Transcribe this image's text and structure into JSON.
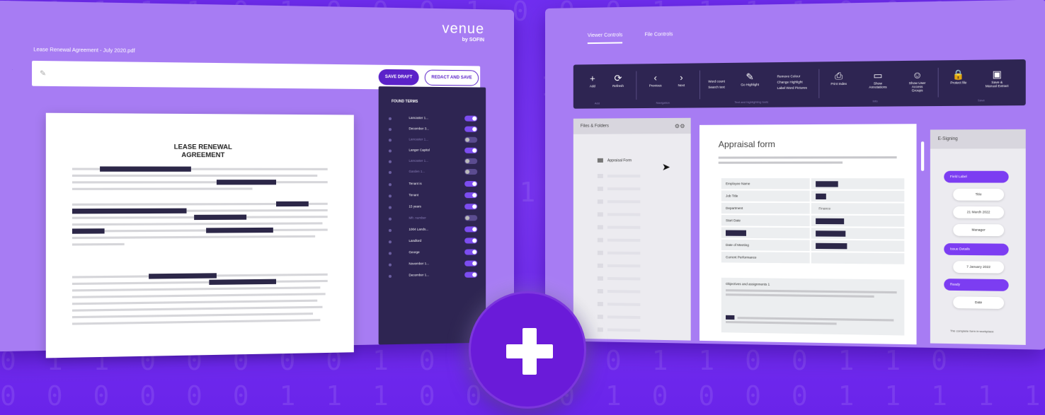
{
  "background": {
    "binary_rows": [
      "0 1 1 1 1 0 1 0 0 0 1      0 0      0 1 1 1 1 0 0      1 0 0 1",
      "0 1 0 0     1       0 1 0 1 1 0 1 0 0 0 0      1 1 0 1 0      0",
      "0 1 1 0 1 1 0 0 0 0 1 1     0 1 0 1 1     1      1 0 0 1 1 0",
      "0 1 1 0 0      0 0      0 1 0 1      1 0      0 1 1      0 0 1 1 0",
      "0 0 0 0 0 0 1 1 1 0 0      1 0 1 0 0 0 0 1 1 1 1 1 0 1 1 0 1 0 1"
    ]
  },
  "left_panel": {
    "logo": "venue",
    "logo_sub": "by SOFIN",
    "document_title": "Lease Renewal Agreement - July 2020.pdf",
    "save_button": "SAVE DRAFT",
    "redact_button": "REDACT AND SAVE",
    "page_heading_line1": "LEASE RENEWAL",
    "page_heading_line2": "AGREEMENT",
    "found_terms_title": "FOUND TERMS",
    "found_terms": [
      {
        "label": "Lancaster 1...",
        "on": true
      },
      {
        "label": "December 3...",
        "on": true
      },
      {
        "label": "Lancaster 1...",
        "on": false
      },
      {
        "label": "Langer Capitol",
        "on": true
      },
      {
        "label": "Lancaster 1...",
        "on": false
      },
      {
        "label": "Garden 1...",
        "on": false
      },
      {
        "label": "Tenant is",
        "on": true
      },
      {
        "label": "Tenant",
        "on": true
      },
      {
        "label": "15 years",
        "on": true
      },
      {
        "label": "Mfr. number",
        "on": false
      },
      {
        "label": "1004 Lands...",
        "on": true
      },
      {
        "label": "Landlord",
        "on": true
      },
      {
        "label": "George",
        "on": true
      },
      {
        "label": "November 1...",
        "on": true
      },
      {
        "label": "December 1...",
        "on": true
      }
    ]
  },
  "right_panel": {
    "tabs": [
      "Viewer Controls",
      "File Controls"
    ],
    "toolbar_items": [
      {
        "glyph": "+",
        "label": "Add"
      },
      {
        "glyph": "⟳",
        "label": "Refresh"
      },
      {
        "glyph": "‹",
        "label": "Previous"
      },
      {
        "glyph": "›",
        "label": "Next"
      },
      {
        "glyph": "⎙",
        "label": "Print Index"
      },
      {
        "glyph": "▭",
        "label": "Show Annotations"
      },
      {
        "glyph": "☺",
        "label": "Show User Access Groups"
      },
      {
        "glyph": "🔒",
        "label": "Protect file"
      },
      {
        "glyph": "▣",
        "label": "Save & Manual Extract"
      }
    ],
    "toolbar_words": {
      "word1": "Word count",
      "word2": "Search text",
      "marker": "Go Highlight",
      "colors1": "Remove Colour",
      "colors2": "Change Highlight",
      "colors3": "Label Word Pictures"
    },
    "toolbar_groups": [
      "Add",
      "Navigation",
      "Text and highlighting tools",
      "Info",
      "Save"
    ],
    "files_title": "Files & Folders",
    "selected_file": "Appraisal Form",
    "appraisal_title": "Appraisal form",
    "appraisal_rows": [
      {
        "key": "Employee Name",
        "value": ""
      },
      {
        "key": "Job Title",
        "value": ""
      },
      {
        "key": "Department",
        "value": "Finance"
      },
      {
        "key": "Start Date",
        "value": ""
      },
      {
        "key": "",
        "value": ""
      },
      {
        "key": "Date of Meeting",
        "value": ""
      },
      {
        "key": "Current Performance",
        "value": ""
      }
    ],
    "objective_title": "Objectives and assignments 1",
    "signing_title": "E-Signing",
    "signing_items": [
      {
        "text": "Field Label",
        "style": "purple"
      },
      {
        "text": "Title",
        "style": "white"
      },
      {
        "text": "21 March 2022",
        "style": "white"
      },
      {
        "text": "Manager",
        "style": "white"
      },
      {
        "text": "Issue Details",
        "style": "purple"
      },
      {
        "text": "7 January 2022",
        "style": "white"
      },
      {
        "text": "Ready",
        "style": "purple"
      },
      {
        "text": "Date",
        "style": "white"
      }
    ],
    "signing_footer": "The complete form in workplace"
  }
}
